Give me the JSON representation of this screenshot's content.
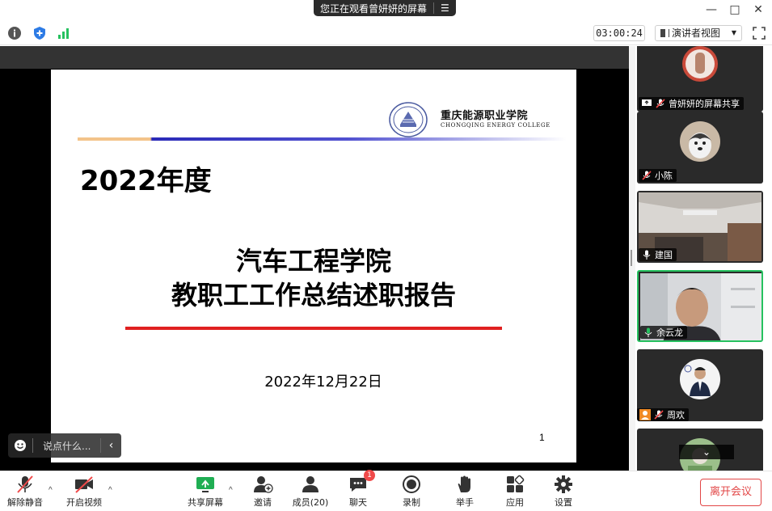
{
  "titlebar": {
    "share_banner": "您正在观看曾妍妍的屏幕",
    "banner_menu_icon": "list-icon"
  },
  "window_controls": [
    "minimize-icon",
    "maximize-icon",
    "close-icon"
  ],
  "infobar": {
    "timer": "03:00:24",
    "view_mode": "演讲者视图",
    "icons": [
      "info-icon",
      "security-shield-icon",
      "signal-strength-icon",
      "fullscreen-icon"
    ]
  },
  "slide": {
    "school_cn": "重庆能源职业学院",
    "school_en": "CHONGQING ENERGY COLLEGE",
    "year": "2022年度",
    "title_line1": "汽车工程学院",
    "title_line2": "教职工工作总结述职报告",
    "date": "2022年12月22日",
    "page": "1"
  },
  "quick_chat": {
    "placeholder": "说点什么..."
  },
  "participants": [
    {
      "name": "曾妍妍的屏幕共享",
      "type": "screen-share"
    },
    {
      "name": "小陈",
      "type": "avatar"
    },
    {
      "name": "建国",
      "type": "video"
    },
    {
      "name": "余云龙",
      "type": "video",
      "speaking": true
    },
    {
      "name": "周欢",
      "type": "avatar",
      "host": true
    },
    {
      "name": "",
      "type": "avatar"
    }
  ],
  "toolbar": {
    "unmute": "解除静音",
    "start_video": "开启视频",
    "share_screen": "共享屏幕",
    "invite": "邀请",
    "members": "成员(20)",
    "chat": "聊天",
    "chat_badge": "1",
    "record": "录制",
    "raise_hand": "举手",
    "apps": "应用",
    "settings": "设置",
    "leave": "离开会议"
  },
  "colors": {
    "accent_green": "#26c15f",
    "leave_red": "#e24646",
    "slide_red_line": "#e02020",
    "slide_blue_line": "#2a2ab8"
  }
}
